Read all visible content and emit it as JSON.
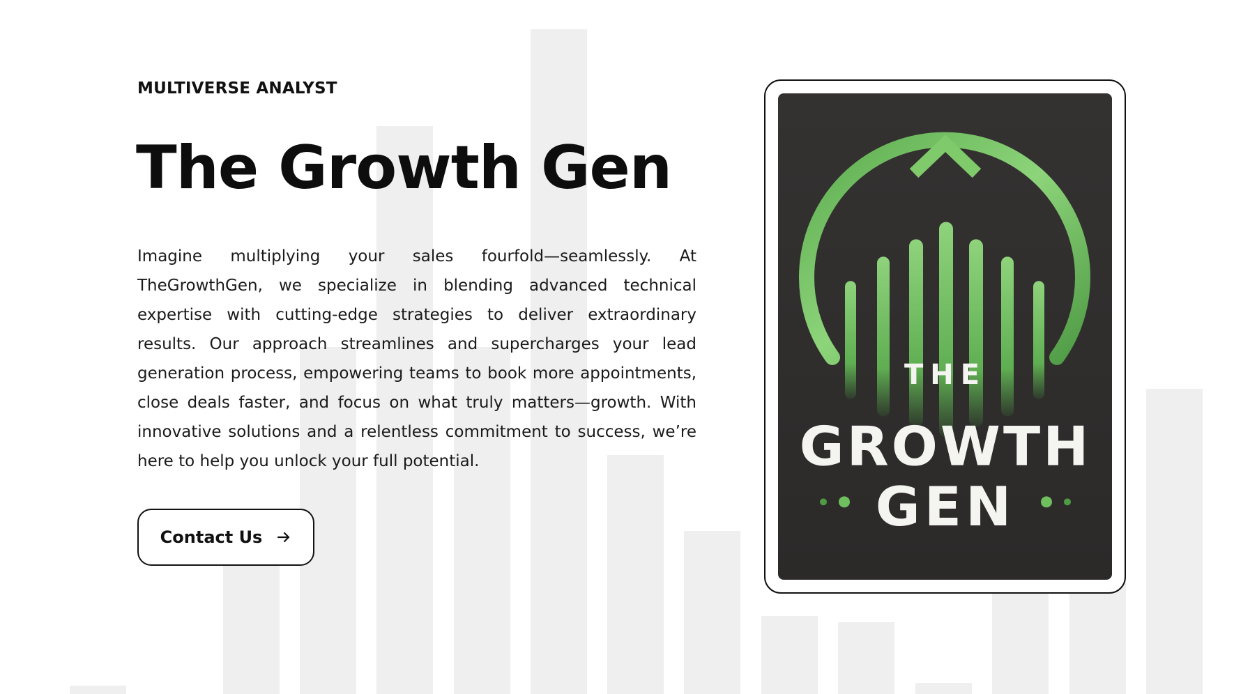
{
  "header": {
    "eyebrow": "MULTIVERSE ANALYST",
    "title": "The Growth Gen"
  },
  "main": {
    "description": "Imagine multiplying your sales fourfold—seamlessly. At TheGrowthGen, we specialize in blending advanced technical expertise with cutting-edge strategies to deliver extraordinary results. Our approach streamlines and supercharges your lead generation process, empowering teams to book more appointments, close deals faster, and focus on what truly matters—growth. With innovative solutions and a relentless commitment to success, we’re here to help you unlock your full potential.",
    "cta_label": "Contact Us",
    "cta_icon": "arrow-right-icon"
  },
  "logo": {
    "line1": "THE",
    "line2": "GROWTH",
    "line3": "GEN",
    "colors": {
      "background": "#302e2d",
      "green": "#6fbf5f",
      "text": "#f4f4f0"
    }
  },
  "theme": {
    "background_bars": "#efefef",
    "text": "#111111"
  }
}
